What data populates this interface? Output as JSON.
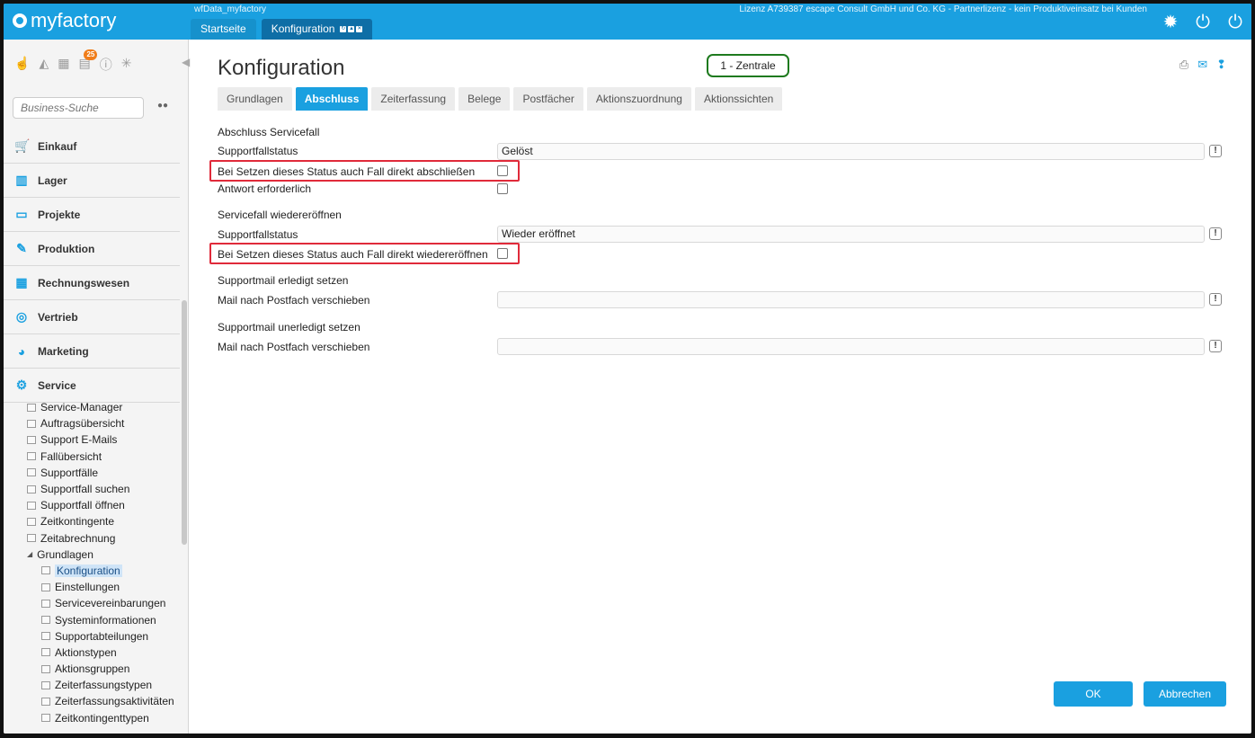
{
  "app": {
    "logo": "myfactory",
    "database": "wfData_myfactory",
    "license": "Lizenz A739387 escape Consult GmbH und Co. KG - Partnerlizenz - kein Produktiveinsatz bei Kunden",
    "top_tabs": [
      {
        "label": "Startseite"
      },
      {
        "label": "Konfiguration"
      }
    ]
  },
  "sidebar": {
    "badge_count": "25",
    "search_placeholder": "Business-Suche",
    "menu": [
      {
        "label": "Einkauf",
        "icon": "cart-icon"
      },
      {
        "label": "Lager",
        "icon": "warehouse-icon"
      },
      {
        "label": "Projekte",
        "icon": "presentation-icon"
      },
      {
        "label": "Produktion",
        "icon": "production-icon"
      },
      {
        "label": "Rechnungswesen",
        "icon": "grid-icon"
      },
      {
        "label": "Vertrieb",
        "icon": "sales-icon"
      },
      {
        "label": "Marketing",
        "icon": "marketing-icon"
      },
      {
        "label": "Service",
        "icon": "gear-icon"
      }
    ],
    "service_items": [
      "Service-Manager",
      "Auftragsübersicht",
      "Support E-Mails",
      "Fallübersicht",
      "Supportfälle",
      "Supportfall suchen",
      "Supportfall öffnen",
      "Zeitkontingente",
      "Zeitabrechnung"
    ],
    "grundlagen_label": "Grundlagen",
    "grundlagen_items": [
      "Konfiguration",
      "Einstellungen",
      "Servicevereinbarungen",
      "Systeminformationen",
      "Supportabteilungen",
      "Aktionstypen",
      "Aktionsgruppen",
      "Zeiterfassungstypen",
      "Zeiterfassungsaktivitäten",
      "Zeitkontingenttypen"
    ]
  },
  "main": {
    "title": "Konfiguration",
    "badge": "1 - Zentrale",
    "tabs": [
      "Grundlagen",
      "Abschluss",
      "Zeiterfassung",
      "Belege",
      "Postfächer",
      "Aktionszuordnung",
      "Aktionssichten"
    ],
    "active_tab": "Abschluss",
    "form": {
      "s1_header": "Abschluss Servicefall",
      "s1_status_label": "Supportfallstatus",
      "s1_status_value": "Gelöst",
      "s1_close_label": "Bei Setzen dieses Status auch Fall direkt abschließen",
      "s1_answer_label": "Antwort erforderlich",
      "s2_header": "Servicefall wiedereröffnen",
      "s2_status_label": "Supportfallstatus",
      "s2_status_value": "Wieder eröffnet",
      "s2_reopen_label": "Bei Setzen dieses Status auch Fall direkt wiedereröffnen",
      "s3_header": "Supportmail erledigt setzen",
      "s3_move_label": "Mail nach Postfach verschieben",
      "s3_move_value": "",
      "s4_header": "Supportmail unerledigt setzen",
      "s4_move_label": "Mail nach Postfach verschieben",
      "s4_move_value": ""
    },
    "ok_label": "OK",
    "cancel_label": "Abbrechen"
  }
}
